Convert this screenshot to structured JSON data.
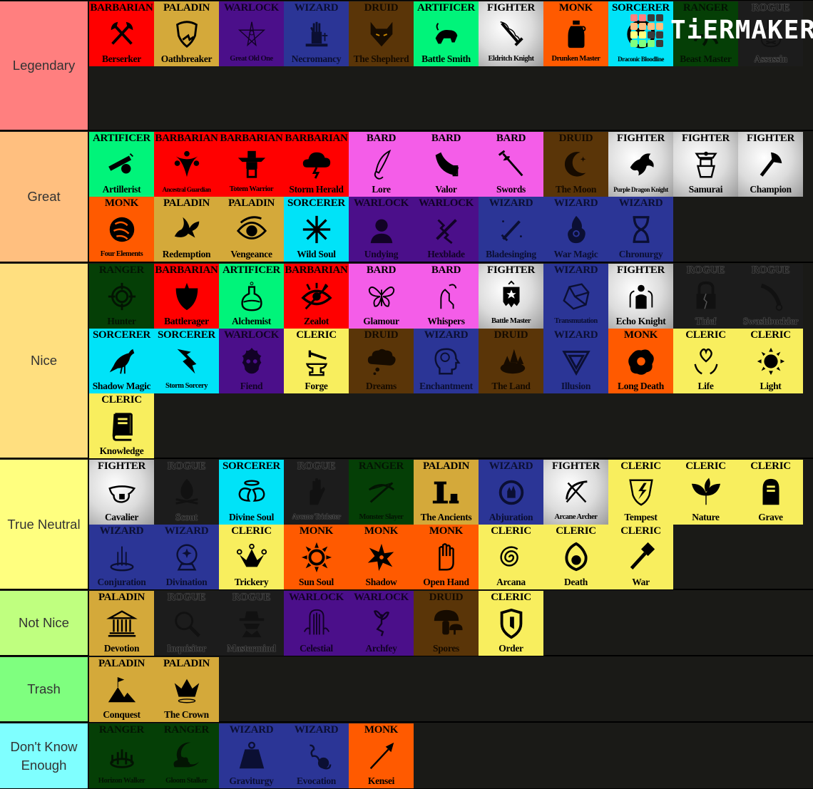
{
  "app": {
    "logo_text": "TiERMAKER",
    "logo_grid_colors": [
      [
        "#ff7f7f",
        "#ff7f7f",
        "#3a3a3a",
        "#3a3a3a"
      ],
      [
        "#ffbf7f",
        "#ffbf7f",
        "#ffbf7f",
        "#ffbf7f"
      ],
      [
        "#ffff7f",
        "#ffff7f",
        "#3a3a3a",
        "#3a3a3a"
      ],
      [
        "#7fff7f",
        "#7fff7f",
        "#7fff7f",
        "#3a3a3a"
      ]
    ]
  },
  "class_colors": {
    "BARBARIAN": {
      "bg": "#ff0000",
      "fg": "#000000"
    },
    "PALADIN": {
      "bg": "#d4a93a",
      "fg": "#000000"
    },
    "WARLOCK": {
      "bg": "#4b0f8a",
      "fg": "#120226"
    },
    "WIZARD": {
      "bg": "#2b3596",
      "fg": "#0b0f33"
    },
    "DRUID": {
      "bg": "#5a3508",
      "fg": "#160b00"
    },
    "ARTIFICER": {
      "bg": "#00f47a",
      "fg": "#000000"
    },
    "FIGHTER": {
      "bg": "#e2e2e2",
      "fg": "#000000"
    },
    "MONK": {
      "bg": "#ff5a00",
      "fg": "#000000"
    },
    "SORCERER": {
      "bg": "#00e3f8",
      "fg": "#000000"
    },
    "RANGER": {
      "bg": "#053f06",
      "fg": "#031403"
    },
    "ROGUE": {
      "bg": "#1c1c1c",
      "fg": "#111111"
    },
    "BARD": {
      "bg": "#f45de8",
      "fg": "#000000"
    },
    "CLERIC": {
      "bg": "#f8ee5e",
      "fg": "#000000"
    }
  },
  "tiers": [
    {
      "label": "Legendary",
      "color": "#ff7f7f",
      "items": [
        {
          "class": "BARBARIAN",
          "subclass": "Berserker",
          "icon": "crossed-axes-icon"
        },
        {
          "class": "PALADIN",
          "subclass": "Oathbreaker",
          "icon": "broken-shield-icon"
        },
        {
          "class": "WARLOCK",
          "subclass": "Great Old One",
          "icon": "tentacle-star-icon"
        },
        {
          "class": "WIZARD",
          "subclass": "Necromancy",
          "icon": "zombie-hand-icon"
        },
        {
          "class": "DRUID",
          "subclass": "The Shepherd",
          "icon": "wolf-head-icon"
        },
        {
          "class": "ARTIFICER",
          "subclass": "Battle Smith",
          "icon": "steel-defender-icon"
        },
        {
          "class": "FIGHTER",
          "subclass": "Eldritch Knight",
          "icon": "flaming-sword-icon"
        },
        {
          "class": "MONK",
          "subclass": "Drunken Master",
          "icon": "jug-icon"
        },
        {
          "class": "SORCERER",
          "subclass": "Draconic Bloodline",
          "icon": "dragon-circle-icon"
        },
        {
          "class": "RANGER",
          "subclass": "Beast Master",
          "icon": "claw-icon"
        },
        {
          "class": "ROGUE",
          "subclass": "Assassin",
          "icon": "poison-bottle-icon"
        }
      ]
    },
    {
      "label": "Great",
      "color": "#ffbf7f",
      "items": [
        {
          "class": "ARTIFICER",
          "subclass": "Artillerist",
          "icon": "cannon-icon"
        },
        {
          "class": "BARBARIAN",
          "subclass": "Ancestral Guardian",
          "icon": "spirit-guardian-icon"
        },
        {
          "class": "BARBARIAN",
          "subclass": "Totem Warrior",
          "icon": "totem-icon"
        },
        {
          "class": "BARBARIAN",
          "subclass": "Storm Herald",
          "icon": "storm-cloud-icon"
        },
        {
          "class": "BARD",
          "subclass": "Lore",
          "icon": "quill-icon"
        },
        {
          "class": "BARD",
          "subclass": "Valor",
          "icon": "war-horn-icon"
        },
        {
          "class": "BARD",
          "subclass": "Swords",
          "icon": "rapier-icon"
        },
        {
          "class": "DRUID",
          "subclass": "The Moon",
          "icon": "crescent-moon-icon"
        },
        {
          "class": "FIGHTER",
          "subclass": "Purple Dragon Knight",
          "icon": "dragon-head-icon"
        },
        {
          "class": "FIGHTER",
          "subclass": "Samurai",
          "icon": "samurai-armor-icon"
        },
        {
          "class": "FIGHTER",
          "subclass": "Champion",
          "icon": "axe-icon"
        },
        {
          "class": "MONK",
          "subclass": "Four Elements",
          "icon": "elements-swirl-icon"
        },
        {
          "class": "PALADIN",
          "subclass": "Redemption",
          "icon": "dove-icon"
        },
        {
          "class": "PALADIN",
          "subclass": "Vengeance",
          "icon": "flaming-eye-icon"
        },
        {
          "class": "SORCERER",
          "subclass": "Wild Soul",
          "icon": "chaos-star-icon"
        },
        {
          "class": "WARLOCK",
          "subclass": "Undying",
          "icon": "undead-head-icon"
        },
        {
          "class": "WARLOCK",
          "subclass": "Hexblade",
          "icon": "lightning-sword-icon"
        },
        {
          "class": "WIZARD",
          "subclass": "Bladesinging",
          "icon": "sparkle-sword-icon"
        },
        {
          "class": "WIZARD",
          "subclass": "War Magic",
          "icon": "magic-flame-icon"
        },
        {
          "class": "WIZARD",
          "subclass": "Chronurgy",
          "icon": "hourglass-icon"
        }
      ]
    },
    {
      "label": "Nice",
      "color": "#ffdf7f",
      "items": [
        {
          "class": "RANGER",
          "subclass": "Hunter",
          "icon": "crosshair-icon"
        },
        {
          "class": "BARBARIAN",
          "subclass": "Battlerager",
          "icon": "spiked-shield-icon"
        },
        {
          "class": "ARTIFICER",
          "subclass": "Alchemist",
          "icon": "flask-icon"
        },
        {
          "class": "BARBARIAN",
          "subclass": "Zealot",
          "icon": "radiant-eye-icon"
        },
        {
          "class": "BARD",
          "subclass": "Glamour",
          "icon": "butterfly-icon"
        },
        {
          "class": "BARD",
          "subclass": "Whispers",
          "icon": "whisper-hand-icon"
        },
        {
          "class": "FIGHTER",
          "subclass": "Battle Master",
          "icon": "star-banner-icon"
        },
        {
          "class": "WIZARD",
          "subclass": "Transmutation",
          "icon": "gem-icon"
        },
        {
          "class": "FIGHTER",
          "subclass": "Echo Knight",
          "icon": "echo-figures-icon"
        },
        {
          "class": "ROGUE",
          "subclass": "Thief",
          "icon": "broken-lock-icon"
        },
        {
          "class": "ROGUE",
          "subclass": "Swashbuckler",
          "icon": "cutlass-icon"
        },
        {
          "class": "SORCERER",
          "subclass": "Shadow Magic",
          "icon": "raven-icon"
        },
        {
          "class": "SORCERER",
          "subclass": "Storm Sorcery",
          "icon": "lightning-bolt-icon"
        },
        {
          "class": "WARLOCK",
          "subclass": "Fiend",
          "icon": "flaming-skull-icon"
        },
        {
          "class": "CLERIC",
          "subclass": "Forge",
          "icon": "anvil-hammer-icon"
        },
        {
          "class": "DRUID",
          "subclass": "Dreams",
          "icon": "thought-cloud-icon"
        },
        {
          "class": "WIZARD",
          "subclass": "Enchantment",
          "icon": "mind-head-icon"
        },
        {
          "class": "DRUID",
          "subclass": "The Land",
          "icon": "forest-island-icon"
        },
        {
          "class": "WIZARD",
          "subclass": "Illusion",
          "icon": "impossible-triangle-icon"
        },
        {
          "class": "MONK",
          "subclass": "Long Death",
          "icon": "skull-splat-icon"
        },
        {
          "class": "CLERIC",
          "subclass": "Life",
          "icon": "heart-hands-icon"
        },
        {
          "class": "CLERIC",
          "subclass": "Light",
          "icon": "sun-icon"
        },
        {
          "class": "CLERIC",
          "subclass": "Knowledge",
          "icon": "book-icon"
        }
      ]
    },
    {
      "label": "True Neutral",
      "color": "#ffff7f",
      "items": [
        {
          "class": "FIGHTER",
          "subclass": "Cavalier",
          "icon": "saddle-icon"
        },
        {
          "class": "ROGUE",
          "subclass": "Scout",
          "icon": "campfire-icon"
        },
        {
          "class": "SORCERER",
          "subclass": "Divine Soul",
          "icon": "halo-wings-icon"
        },
        {
          "class": "ROGUE",
          "subclass": "Arcane Trickster",
          "icon": "magic-hand-icon"
        },
        {
          "class": "RANGER",
          "subclass": "Monster Slayer",
          "icon": "crossbow-icon"
        },
        {
          "class": "PALADIN",
          "subclass": "The Ancients",
          "icon": "pillars-icon"
        },
        {
          "class": "WIZARD",
          "subclass": "Abjuration",
          "icon": "ward-hand-icon"
        },
        {
          "class": "FIGHTER",
          "subclass": "Arcane Archer",
          "icon": "bow-arrow-icon"
        },
        {
          "class": "CLERIC",
          "subclass": "Tempest",
          "icon": "lightning-shield-icon"
        },
        {
          "class": "CLERIC",
          "subclass": "Nature",
          "icon": "leaves-icon"
        },
        {
          "class": "CLERIC",
          "subclass": "Grave",
          "icon": "tombstone-icon"
        },
        {
          "class": "WIZARD",
          "subclass": "Conjuration",
          "icon": "summoning-circle-icon"
        },
        {
          "class": "WIZARD",
          "subclass": "Divination",
          "icon": "crystal-ball-icon"
        },
        {
          "class": "CLERIC",
          "subclass": "Trickery",
          "icon": "jester-crown-icon"
        },
        {
          "class": "MONK",
          "subclass": "Sun Soul",
          "icon": "radiant-sun-icon"
        },
        {
          "class": "MONK",
          "subclass": "Shadow",
          "icon": "shuriken-icon"
        },
        {
          "class": "MONK",
          "subclass": "Open Hand",
          "icon": "open-hand-icon"
        },
        {
          "class": "CLERIC",
          "subclass": "Arcana",
          "icon": "spiral-icon"
        },
        {
          "class": "CLERIC",
          "subclass": "Death",
          "icon": "skull-flame-icon"
        },
        {
          "class": "CLERIC",
          "subclass": "War",
          "icon": "warhammer-icon"
        }
      ]
    },
    {
      "label": "Not Nice",
      "color": "#bfff7f",
      "items": [
        {
          "class": "PALADIN",
          "subclass": "Devotion",
          "icon": "temple-icon"
        },
        {
          "class": "ROGUE",
          "subclass": "Inquisitor",
          "icon": "magnifying-glass-icon"
        },
        {
          "class": "ROGUE",
          "subclass": "Mastermind",
          "icon": "spy-icon"
        },
        {
          "class": "WARLOCK",
          "subclass": "Celestial",
          "icon": "celestial-gate-icon"
        },
        {
          "class": "WARLOCK",
          "subclass": "Archfey",
          "icon": "fairy-icon"
        },
        {
          "class": "DRUID",
          "subclass": "Spores",
          "icon": "mushroom-icon"
        },
        {
          "class": "CLERIC",
          "subclass": "Order",
          "icon": "order-shield-icon"
        }
      ]
    },
    {
      "label": "Trash",
      "color": "#7fff7f",
      "items": [
        {
          "class": "PALADIN",
          "subclass": "Conquest",
          "icon": "mountain-flag-icon"
        },
        {
          "class": "PALADIN",
          "subclass": "The Crown",
          "icon": "crown-icon"
        }
      ]
    },
    {
      "label": "Don't Know\nEnough",
      "color": "#7fffff",
      "items": [
        {
          "class": "RANGER",
          "subclass": "Horizon Walker",
          "icon": "portal-ring-icon"
        },
        {
          "class": "RANGER",
          "subclass": "Gloom Stalker",
          "icon": "moon-cloud-icon"
        },
        {
          "class": "WIZARD",
          "subclass": "Graviturgy",
          "icon": "weight-icon"
        },
        {
          "class": "WIZARD",
          "subclass": "Evocation",
          "icon": "magic-smoke-icon"
        },
        {
          "class": "MONK",
          "subclass": "Kensei",
          "icon": "spear-icon"
        }
      ]
    }
  ]
}
